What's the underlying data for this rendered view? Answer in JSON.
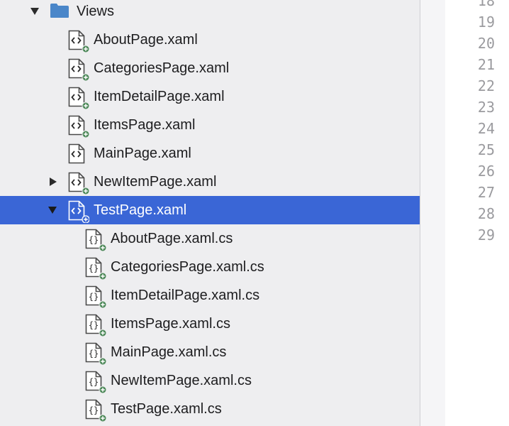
{
  "tree": {
    "folder": {
      "label": "Views",
      "expanded": true,
      "icon": "folder-icon",
      "color": "#4a86c9"
    },
    "items": [
      {
        "label": "AboutPage.xaml",
        "icon": "xaml-file-icon"
      },
      {
        "label": "CategoriesPage.xaml",
        "icon": "xaml-file-icon"
      },
      {
        "label": "ItemDetailPage.xaml",
        "icon": "xaml-file-icon"
      },
      {
        "label": "ItemsPage.xaml",
        "icon": "xaml-file-icon"
      },
      {
        "label": "MainPage.xaml",
        "icon": "xaml-file-icon"
      },
      {
        "label": "NewItemPage.xaml",
        "icon": "xaml-file-icon",
        "disclosure": "collapsed"
      },
      {
        "label": "TestPage.xaml",
        "icon": "xaml-file-icon",
        "disclosure": "expanded",
        "selected": true
      }
    ],
    "children": [
      {
        "label": "AboutPage.xaml.cs",
        "icon": "csharp-file-icon"
      },
      {
        "label": "CategoriesPage.xaml.cs",
        "icon": "csharp-file-icon"
      },
      {
        "label": "ItemDetailPage.xaml.cs",
        "icon": "csharp-file-icon"
      },
      {
        "label": "ItemsPage.xaml.cs",
        "icon": "csharp-file-icon"
      },
      {
        "label": "MainPage.xaml.cs",
        "icon": "csharp-file-icon"
      },
      {
        "label": "NewItemPage.xaml.cs",
        "icon": "csharp-file-icon"
      },
      {
        "label": "TestPage.xaml.cs",
        "icon": "csharp-file-icon"
      }
    ]
  },
  "editor": {
    "line_numbers": [
      "18",
      "19",
      "20",
      "21",
      "22",
      "23",
      "24",
      "25",
      "26",
      "27",
      "28",
      "29"
    ]
  },
  "colors": {
    "selection": "#3a66d6",
    "sidebar_bg": "#eeeef0",
    "badge_green": "#4f8a5b",
    "line_number": "#9a9a9e"
  }
}
